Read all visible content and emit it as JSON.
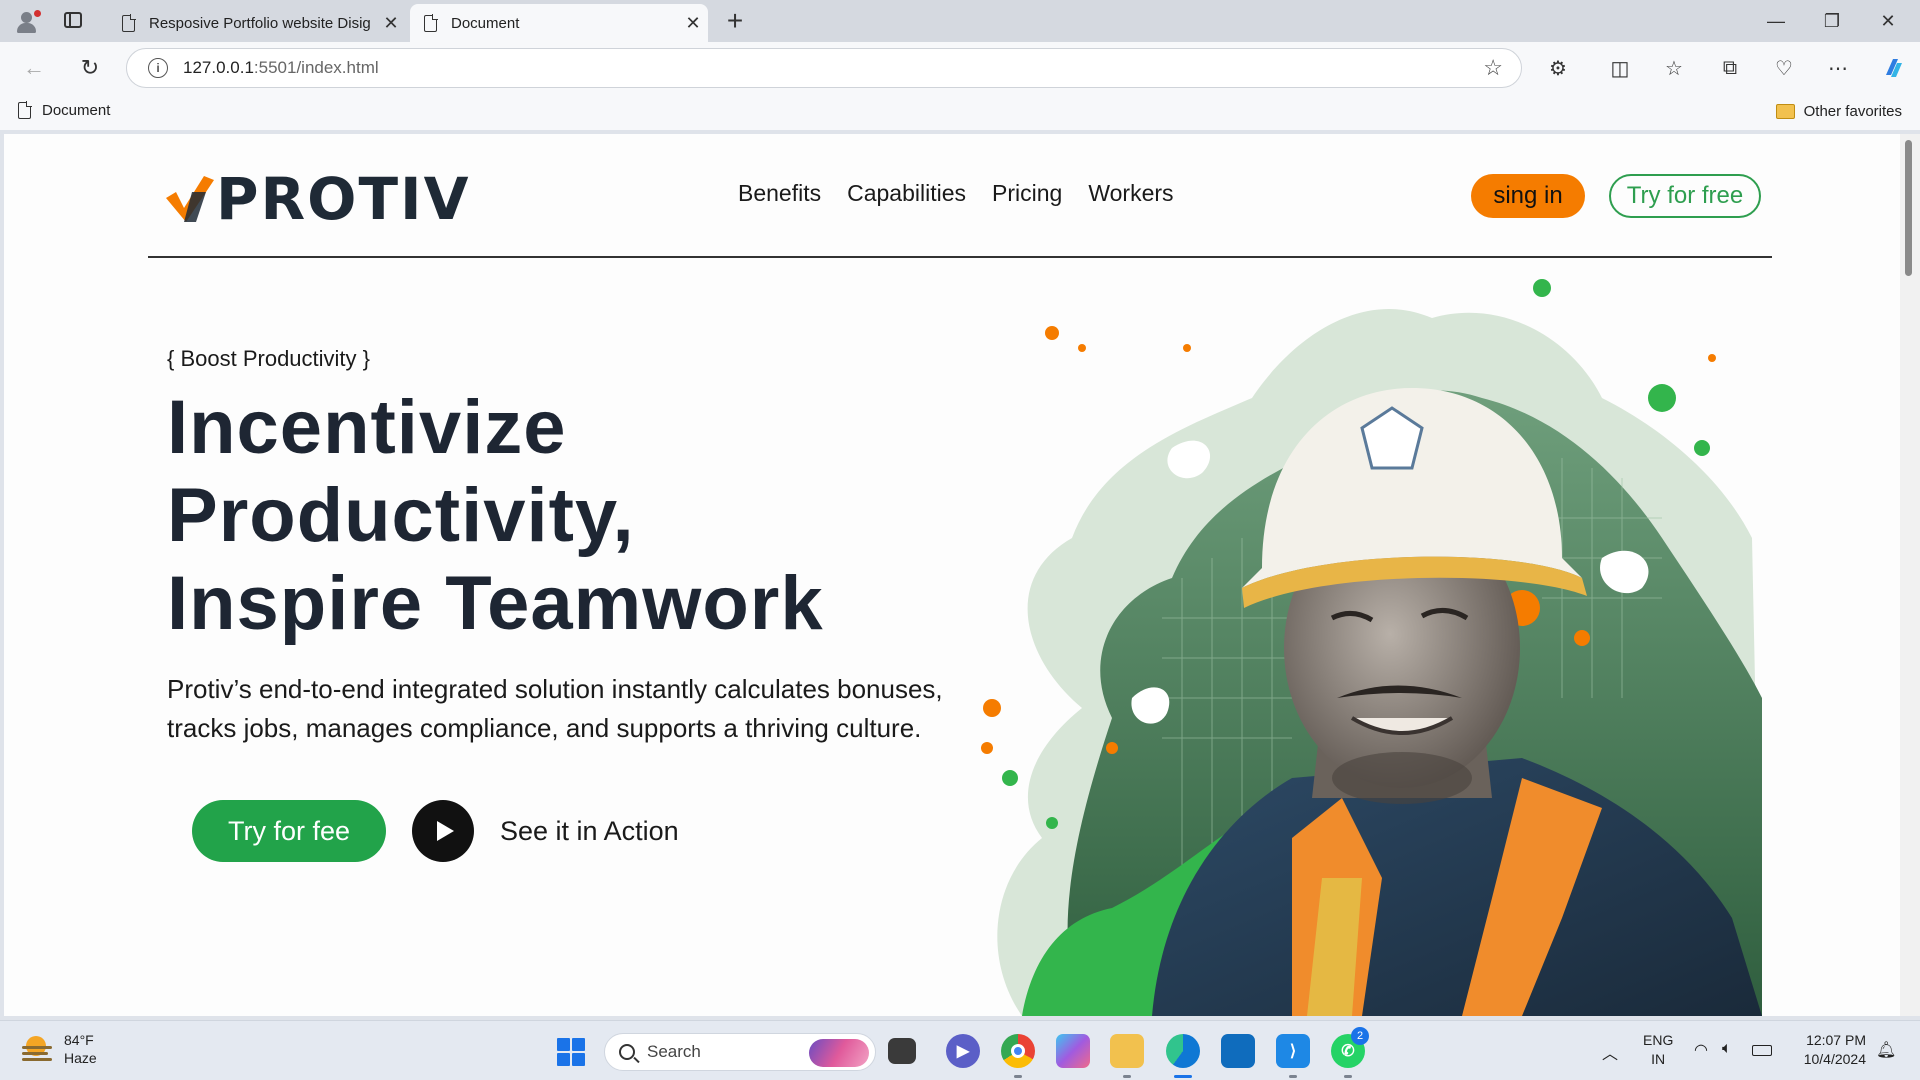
{
  "browser": {
    "tabs": [
      {
        "title": "Resposive Portfolio website Disig",
        "close": "✕"
      },
      {
        "title": "Document",
        "close": "✕"
      }
    ],
    "new_tab": "+",
    "window_controls": {
      "minimize": "—",
      "restore": "❐",
      "close": "✕"
    },
    "url_host": "127.0.0.1",
    "url_rest": ":5501/index.html",
    "favorites": {
      "item": "Document",
      "other": "Other favorites"
    }
  },
  "page": {
    "logo": "PROTIV",
    "nav": [
      "Benefits",
      "Capabilities",
      "Pricing",
      "Workers"
    ],
    "signin_label": "sing in",
    "try_free_label": "Try for free",
    "tagline": "{ Boost Productivity }",
    "headline": [
      "Incentivize",
      "Productivity,",
      "Inspire Teamwork"
    ],
    "description": "Protiv’s end-to-end integrated solution instantly calculates bonuses, tracks jobs, manages compliance, and supports a thriving culture.",
    "cta_primary": "Try for fee",
    "cta_secondary": "See it in Action",
    "colors": {
      "accent_orange": "#f57c00",
      "accent_green": "#22a34a",
      "dark": "#1e2633"
    }
  },
  "taskbar": {
    "weather_temp": "84°F",
    "weather_desc": "Haze",
    "search_placeholder": "Search",
    "whatsapp_badge": "2",
    "lang_top": "ENG",
    "lang_bottom": "IN",
    "time": "12:07 PM",
    "date": "10/4/2024"
  }
}
